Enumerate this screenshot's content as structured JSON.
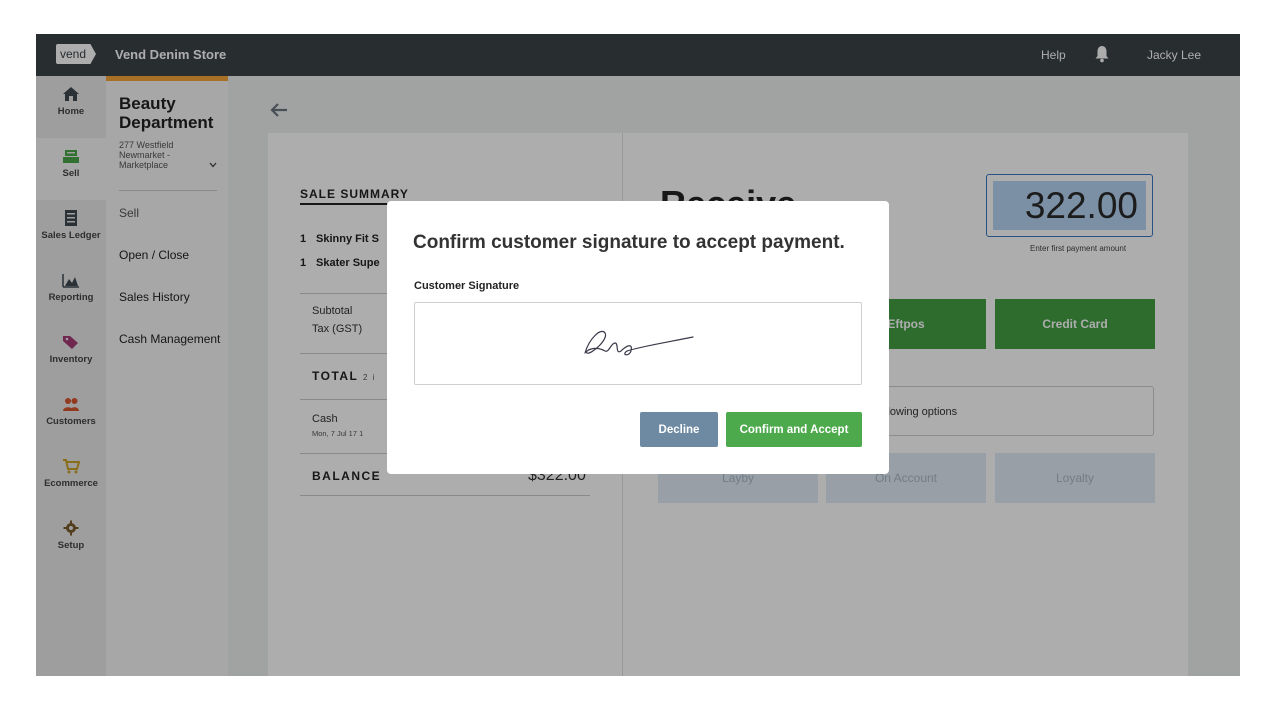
{
  "topbar": {
    "logo_text": "vend",
    "store_name": "Vend Denim Store",
    "help_label": "Help",
    "bell_icon": "bell-icon",
    "user_name": "Jacky Lee"
  },
  "icon_nav": {
    "items": [
      {
        "label": "Home",
        "icon": "home-icon"
      },
      {
        "label": "Sell",
        "icon": "register-icon"
      },
      {
        "label": "Sales Ledger",
        "icon": "ledger-icon"
      },
      {
        "label": "Reporting",
        "icon": "chart-icon"
      },
      {
        "label": "Inventory",
        "icon": "tag-icon"
      },
      {
        "label": "Customers",
        "icon": "customers-icon"
      },
      {
        "label": "Ecommerce",
        "icon": "cart-icon"
      },
      {
        "label": "Setup",
        "icon": "gear-icon"
      }
    ],
    "active": "Sell"
  },
  "sub_nav": {
    "department": "Beauty Department",
    "address": "277 Westfield Newmarket - Marketplace",
    "links": [
      "Sell",
      "Open / Close",
      "Sales History",
      "Cash Management"
    ]
  },
  "sale_summary": {
    "title": "SALE SUMMARY",
    "items": [
      {
        "qty": "1",
        "name": "Skinny Fit S"
      },
      {
        "qty": "1",
        "name": "Skater Supe"
      }
    ],
    "subtotal_label": "Subtotal",
    "tax_label": "Tax (GST)",
    "total_label": "TOTAL",
    "total_suffix": "2 i",
    "payment_method": "Cash",
    "payment_date": "Mon, 7 Jul 17 1",
    "balance_label": "BALANCE",
    "balance_amount": "$322.00"
  },
  "payment": {
    "heading": "Receive",
    "amount": "322.00",
    "amount_hint": "Enter first payment amount",
    "buttons_primary": [
      "Eftpos",
      "Credit Card"
    ],
    "options_text": "llowing options",
    "buttons_secondary": [
      "Layby",
      "On Account",
      "Loyalty"
    ]
  },
  "modal": {
    "title": "Confirm customer signature to accept payment.",
    "signature_label": "Customer Signature",
    "decline_label": "Decline",
    "accept_label": "Confirm and Accept"
  },
  "colors": {
    "topbar": "#3c4348",
    "accent_green": "#4caa4c",
    "decline_blue": "#6d8aa2",
    "selection_blue": "#b6d4f2",
    "orange_tab": "#f7a637"
  }
}
